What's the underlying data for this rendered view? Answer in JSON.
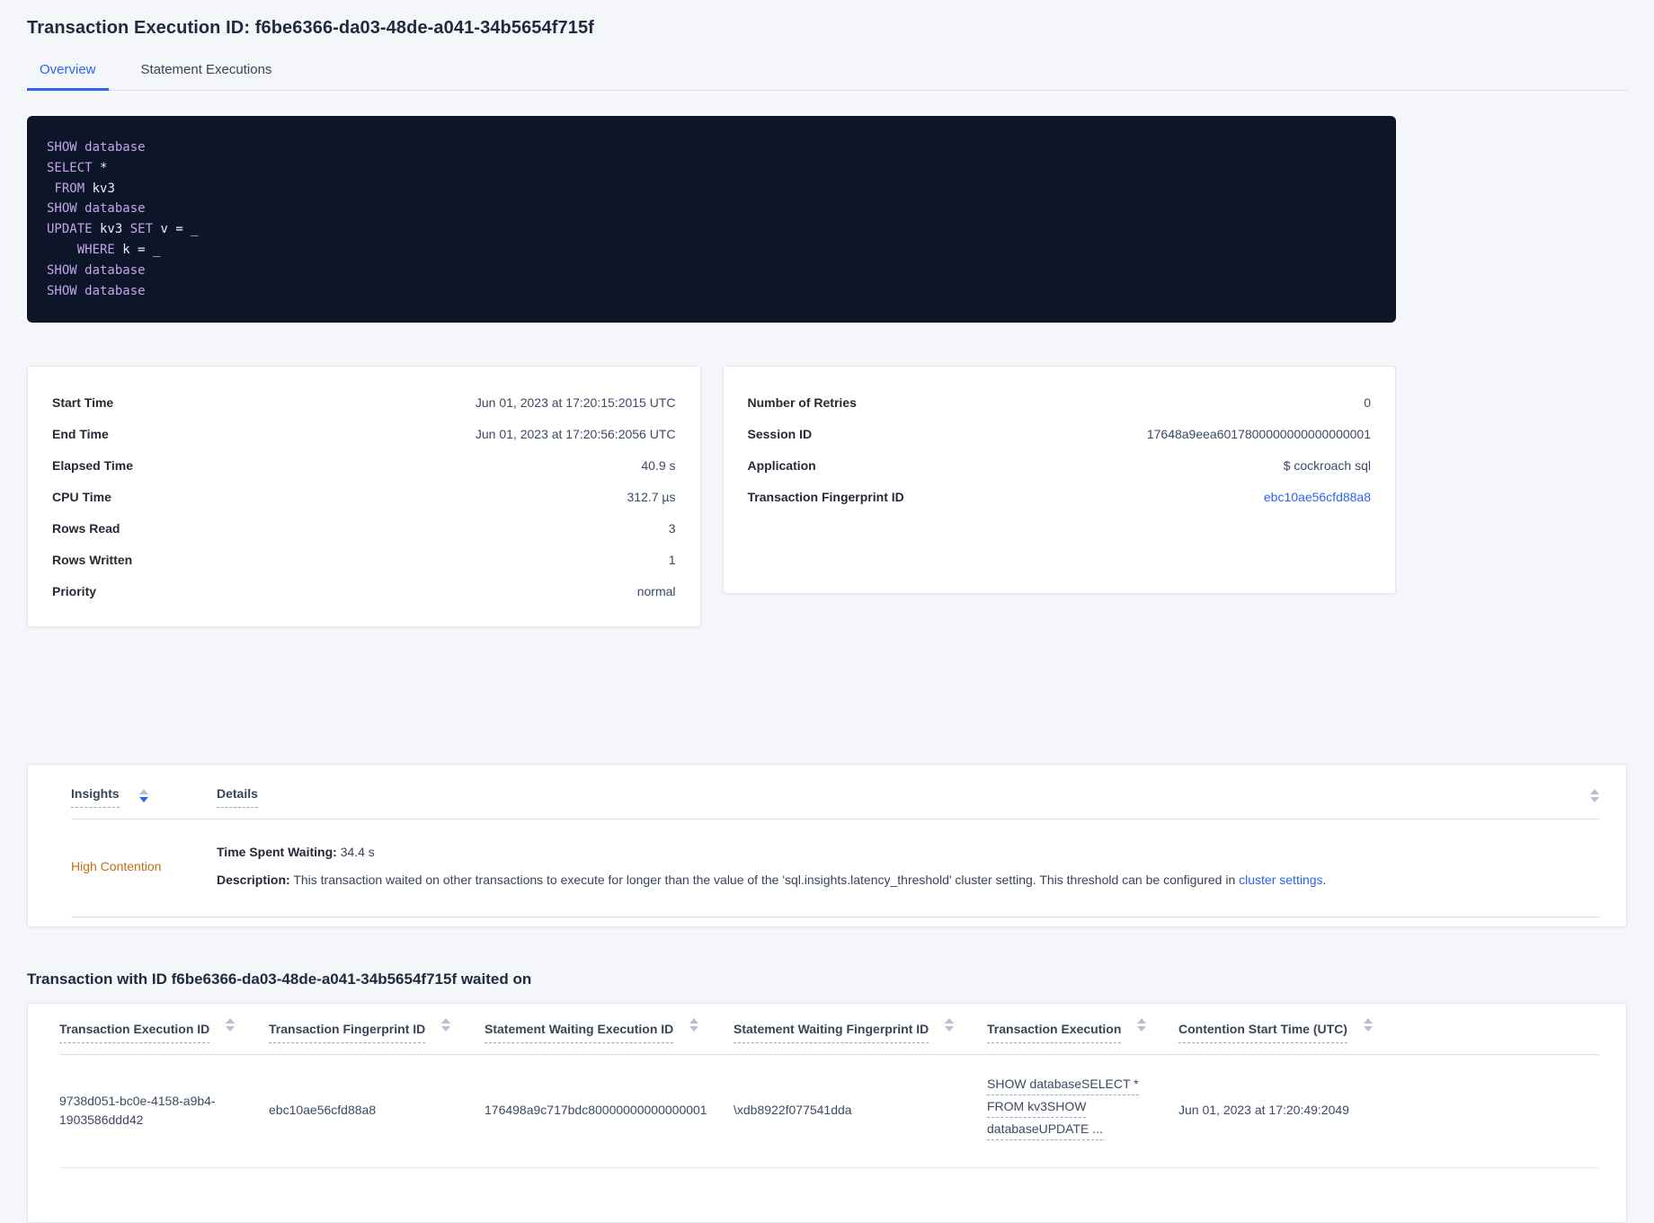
{
  "theme": {
    "page_bg": "#f4f6fa",
    "accent_blue": "#2b63f5",
    "link_blue": "#2b63f5",
    "insight_orange": "#c26e15",
    "sql_bg": "#0d1628",
    "sql_keyword": "#c4a4ea",
    "sql_text": "#f2effa"
  },
  "page": {
    "title": "Transaction Execution ID: f6be6366-da03-48de-a041-34b5654f715f"
  },
  "tabs": [
    {
      "label": "Overview",
      "active": true
    },
    {
      "label": "Statement Executions",
      "active": false
    }
  ],
  "sql_box": {
    "lines": [
      [
        {
          "text": "SHOW database",
          "kw": true
        }
      ],
      [
        {
          "text": "SELECT",
          "kw": true
        },
        {
          "text": " *",
          "kw": false
        }
      ],
      [
        {
          "text": " ",
          "kw": false
        },
        {
          "text": "FROM",
          "kw": true
        },
        {
          "text": " kv3",
          "kw": false
        }
      ],
      [
        {
          "text": "SHOW database",
          "kw": true
        }
      ],
      [
        {
          "text": "UPDATE",
          "kw": true
        },
        {
          "text": " kv3 ",
          "kw": false
        },
        {
          "text": "SET",
          "kw": true
        },
        {
          "text": " v = _",
          "kw": false
        }
      ],
      [
        {
          "text": "    ",
          "kw": false
        },
        {
          "text": "WHERE",
          "kw": true
        },
        {
          "text": " k = _",
          "kw": false
        }
      ],
      [
        {
          "text": "SHOW database",
          "kw": true
        }
      ],
      [
        {
          "text": "SHOW database",
          "kw": true
        }
      ]
    ]
  },
  "summary_left": {
    "rows": [
      {
        "label": "Start Time",
        "value": "Jun 01, 2023 at 17:20:15:2015 UTC"
      },
      {
        "label": "End Time",
        "value": "Jun 01, 2023 at 17:20:56:2056 UTC"
      },
      {
        "label": "Elapsed Time",
        "value": "40.9 s"
      },
      {
        "label": "CPU Time",
        "value": "312.7 µs"
      },
      {
        "label": "Rows Read",
        "value": "3"
      },
      {
        "label": "Rows Written",
        "value": "1"
      },
      {
        "label": "Priority",
        "value": "normal"
      }
    ]
  },
  "summary_right": {
    "rows": [
      {
        "label": "Number of Retries",
        "value": "0"
      },
      {
        "label": "Session ID",
        "value": "17648a9eea6017800000000000000001"
      },
      {
        "label": "Application",
        "value": "$ cockroach sql"
      },
      {
        "label": "Transaction Fingerprint ID",
        "value": "ebc10ae56cfd88a8",
        "link": true
      }
    ]
  },
  "insights": {
    "columns": [
      {
        "label": "Insights",
        "sorted": "desc"
      },
      {
        "label": "Details"
      }
    ],
    "rows": [
      {
        "insight": "High Contention",
        "waiting_label": "Time Spent Waiting:",
        "waiting_value": " 34.4 s",
        "description_label": "Description:",
        "description_text": " This transaction waited on other transactions to execute for longer than the value of the 'sql.insights.latency_threshold' cluster setting. This threshold can be configured in ",
        "description_link": "cluster settings",
        "description_suffix": "."
      }
    ]
  },
  "waited_on": {
    "heading": "Transaction with ID f6be6366-da03-48de-a041-34b5654f715f waited on",
    "columns": [
      "Transaction Execution ID",
      "Transaction Fingerprint ID",
      "Statement Waiting Execution ID",
      "Statement Waiting Fingerprint ID",
      "Transaction Execution",
      "Contention Start Time (UTC)"
    ],
    "rows": [
      {
        "transaction_execution_id": "9738d051-bc0e-4158-a9b4-1903586ddd42",
        "transaction_fingerprint_id": "ebc10ae56cfd88a8",
        "statement_waiting_execution_id": "176498a9c717bdc80000000000000001",
        "statement_waiting_fingerprint_id": "\\xdb8922f077541dda",
        "transaction_execution_lines": [
          "SHOW databaseSELECT *",
          "FROM kv3SHOW",
          "databaseUPDATE ..."
        ],
        "contention_start_time": "Jun 01, 2023 at 17:20:49:2049"
      }
    ]
  }
}
